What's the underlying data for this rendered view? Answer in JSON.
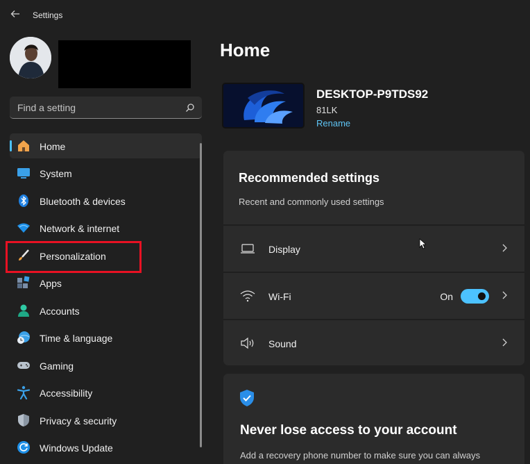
{
  "window": {
    "title": "Settings"
  },
  "search": {
    "placeholder": "Find a setting"
  },
  "nav": {
    "items": [
      {
        "label": "Home",
        "icon": "home-icon",
        "active": true
      },
      {
        "label": "System",
        "icon": "system-icon"
      },
      {
        "label": "Bluetooth & devices",
        "icon": "bluetooth-icon"
      },
      {
        "label": "Network & internet",
        "icon": "wifi-icon"
      },
      {
        "label": "Personalization",
        "icon": "brush-icon",
        "highlighted": true
      },
      {
        "label": "Apps",
        "icon": "apps-icon"
      },
      {
        "label": "Accounts",
        "icon": "accounts-icon"
      },
      {
        "label": "Time & language",
        "icon": "globe-clock-icon"
      },
      {
        "label": "Gaming",
        "icon": "gamepad-icon"
      },
      {
        "label": "Accessibility",
        "icon": "accessibility-icon"
      },
      {
        "label": "Privacy & security",
        "icon": "shield-icon"
      },
      {
        "label": "Windows Update",
        "icon": "update-icon"
      }
    ]
  },
  "main": {
    "title": "Home",
    "device": {
      "name": "DESKTOP-P9TDS92",
      "model": "81LK",
      "rename_label": "Rename"
    },
    "recommended": {
      "title": "Recommended settings",
      "subtitle": "Recent and commonly used settings",
      "rows": [
        {
          "label": "Display",
          "icon": "monitor-icon"
        },
        {
          "label": "Wi-Fi",
          "icon": "wifi-icon",
          "state": "On",
          "toggle_on": true
        },
        {
          "label": "Sound",
          "icon": "speaker-icon"
        }
      ]
    },
    "account_card": {
      "title": "Never lose access to your account",
      "text": "Add a recovery phone number to make sure you can always"
    }
  },
  "colors": {
    "accent": "#4cc2ff",
    "highlight_box": "#e81123",
    "background": "#202020",
    "card": "#2b2b2b"
  }
}
